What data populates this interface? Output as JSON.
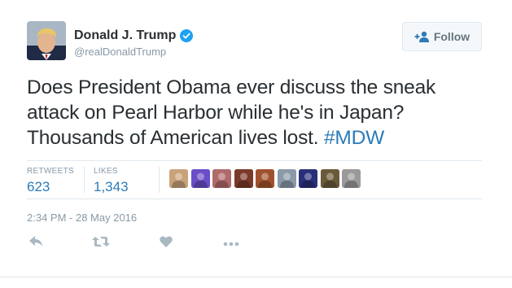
{
  "author": {
    "display_name": "Donald J. Trump",
    "handle": "@realDonaldTrump",
    "verified": true
  },
  "follow_button": {
    "label": "Follow"
  },
  "tweet": {
    "text": "Does President Obama ever discuss the sneak attack on Pearl Harbor while he's in Japan? Thousands of American lives lost.",
    "hashtag": "#MDW",
    "timestamp": "2:34 PM - 28 May 2016"
  },
  "stats": {
    "retweets_label": "RETWEETS",
    "retweets_value": "623",
    "likes_label": "LIKES",
    "likes_value": "1,343"
  },
  "likers": [
    {
      "icon": "liker-avatar",
      "color": "#c9a27a"
    },
    {
      "icon": "liker-avatar",
      "color": "#6b4ec8"
    },
    {
      "icon": "liker-avatar",
      "color": "#b06a6a"
    },
    {
      "icon": "liker-avatar",
      "color": "#7a3a2a"
    },
    {
      "icon": "liker-avatar",
      "color": "#a0522d"
    },
    {
      "icon": "liker-avatar",
      "color": "#8a9aa8"
    },
    {
      "icon": "liker-avatar",
      "color": "#2a2f7a"
    },
    {
      "icon": "liker-avatar",
      "color": "#6a5a3a"
    },
    {
      "icon": "liker-avatar",
      "color": "#9a9a9a"
    }
  ],
  "actions": [
    {
      "name": "reply-icon"
    },
    {
      "name": "retweet-icon"
    },
    {
      "name": "like-icon"
    },
    {
      "name": "more-icon"
    }
  ],
  "colors": {
    "link": "#2b7bb9",
    "muted": "#8899a6",
    "verified": "#1da1f2",
    "text": "#292f33"
  }
}
